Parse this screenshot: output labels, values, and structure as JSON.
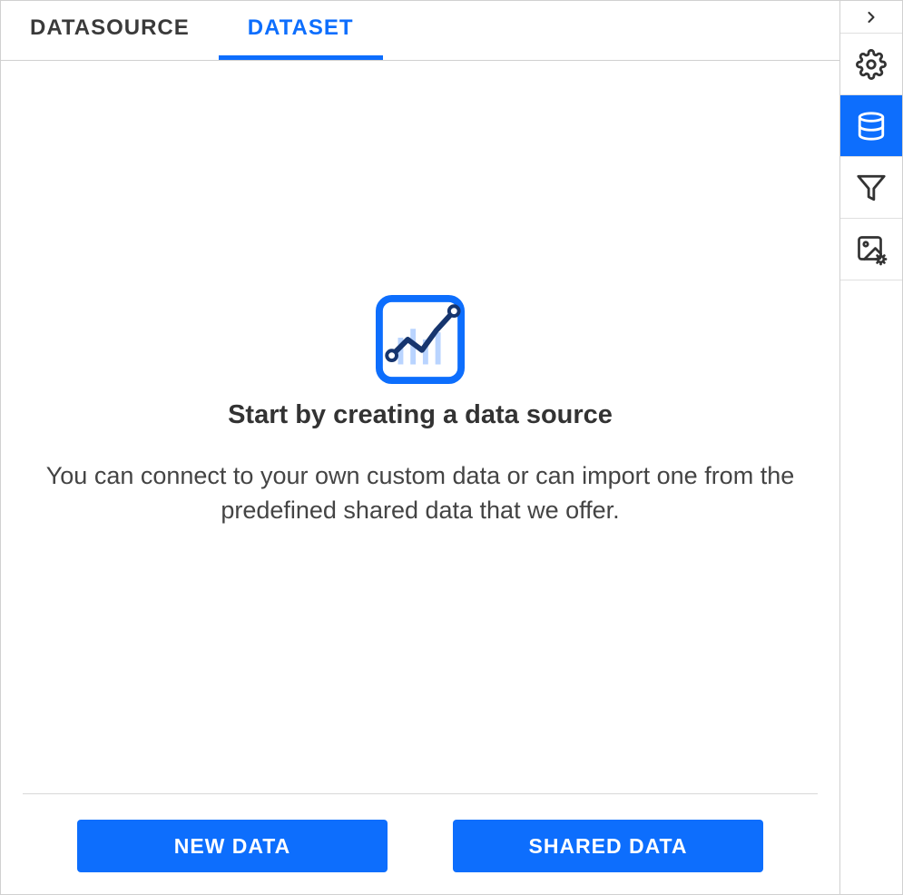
{
  "tabs": {
    "datasource": "DATASOURCE",
    "dataset": "DATASET",
    "active": "dataset"
  },
  "empty_state": {
    "heading": "Start by creating a data source",
    "description": "You can connect to your own custom data or can import one from the predefined shared data that we offer."
  },
  "buttons": {
    "new_data": "NEW DATA",
    "shared_data": "SHARED DATA"
  },
  "sidebar": {
    "collapse": "chevron-right",
    "items": [
      "settings",
      "data",
      "filter",
      "image-settings"
    ],
    "active": "data"
  },
  "colors": {
    "primary": "#0d6efd"
  }
}
